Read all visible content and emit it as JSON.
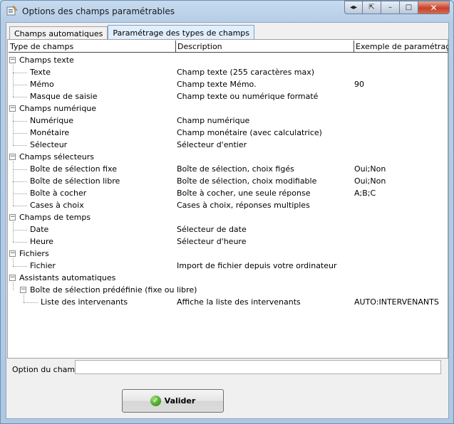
{
  "window": {
    "title": "Options des champs paramétrables",
    "buttons": {
      "nav": "◂▸",
      "export": "⇱",
      "minimize": "–",
      "maximize": "□",
      "close": "✕"
    }
  },
  "tabs": [
    {
      "label": "Champs automatiques",
      "active": false
    },
    {
      "label": "Paramétrage des types de champs",
      "active": true
    }
  ],
  "grid": {
    "columns": [
      "Type de champs",
      "Description",
      "Exemple de paramétrage"
    ],
    "rows": [
      {
        "level": 0,
        "label": "Champs texte",
        "desc": "",
        "example": ""
      },
      {
        "level": 1,
        "label": "Texte",
        "desc": "Champ texte (255 caractères max)",
        "example": ""
      },
      {
        "level": 1,
        "label": "Mémo",
        "desc": "Champ texte Mémo.",
        "example": "90"
      },
      {
        "level": 1,
        "label": "Masque de saisie",
        "desc": "Champ texte ou numérique formaté",
        "example": ""
      },
      {
        "level": 0,
        "label": "Champs numérique",
        "desc": "",
        "example": ""
      },
      {
        "level": 1,
        "label": "Numérique",
        "desc": "Champ numérique",
        "example": ""
      },
      {
        "level": 1,
        "label": "Monétaire",
        "desc": "Champ monétaire (avec calculatrice)",
        "example": ""
      },
      {
        "level": 1,
        "label": "Sélecteur",
        "desc": "Sélecteur d'entier",
        "example": ""
      },
      {
        "level": 0,
        "label": "Champs sélecteurs",
        "desc": "",
        "example": ""
      },
      {
        "level": 1,
        "label": "Boîte de sélection fixe",
        "desc": "Boîte de sélection, choix figés",
        "example": "Oui;Non"
      },
      {
        "level": 1,
        "label": "Boîte de sélection libre",
        "desc": "Boîte de sélection, choix modifiable",
        "example": "Oui;Non"
      },
      {
        "level": 1,
        "label": "Boîte à cocher",
        "desc": "Boîte à cocher, une seule réponse",
        "example": "A;B;C"
      },
      {
        "level": 1,
        "label": "Cases à choix",
        "desc": "Cases à choix, réponses multiples",
        "example": ""
      },
      {
        "level": 0,
        "label": "Champs de temps",
        "desc": "",
        "example": ""
      },
      {
        "level": 1,
        "label": "Date",
        "desc": "Sélecteur de date",
        "example": ""
      },
      {
        "level": 1,
        "label": "Heure",
        "desc": "Sélecteur d'heure",
        "example": ""
      },
      {
        "level": 0,
        "label": "Fichiers",
        "desc": "",
        "example": ""
      },
      {
        "level": 1,
        "label": "Fichier",
        "desc": "Import de fichier depuis votre ordinateur",
        "example": ""
      },
      {
        "level": 0,
        "label": "Assistants automatiques",
        "desc": "",
        "example": ""
      },
      {
        "level": 1,
        "label": "Boîte de sélection prédéfinie (fixe ou libre)",
        "desc": "",
        "example": "",
        "expandable": true
      },
      {
        "level": 2,
        "label": "Liste des intervenants",
        "desc": "Affiche la liste des intervenants",
        "example": "AUTO:INTERVENANTS"
      }
    ]
  },
  "option": {
    "label": "Option du champ",
    "value": ""
  },
  "validate": {
    "label": "Valider"
  },
  "icons": {
    "app": "app-icon",
    "check": "check-icon"
  }
}
